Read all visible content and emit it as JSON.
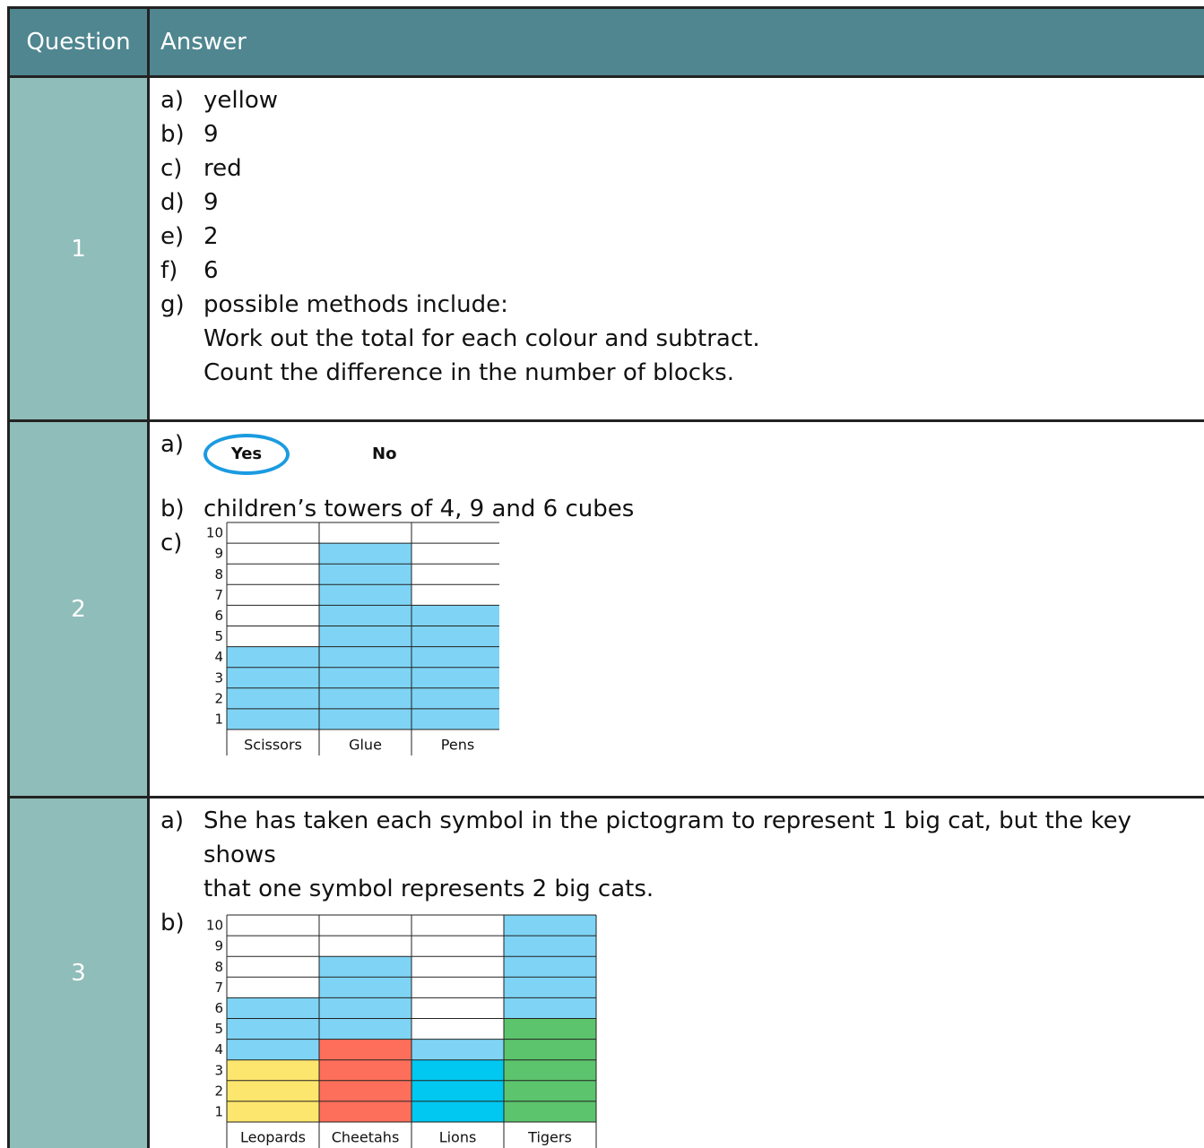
{
  "header": {
    "question": "Question",
    "answer": "Answer"
  },
  "colors": {
    "header_bg": "#4f8690",
    "question_col_bg": "#8fbdb9",
    "bar_blue": "#7fd4f5",
    "circle": "#1a9be0",
    "yellow": "#fde66d",
    "red": "#fe6f5b",
    "cyan": "#00c8f0",
    "green": "#5cc46c"
  },
  "q1": {
    "number": "1",
    "items": [
      {
        "label": "a)",
        "text": "yellow"
      },
      {
        "label": "b)",
        "text": "9"
      },
      {
        "label": "c)",
        "text": "red"
      },
      {
        "label": "d)",
        "text": "9"
      },
      {
        "label": "e)",
        "text": "2"
      },
      {
        "label": "f)",
        "text": "6"
      },
      {
        "label": "g)",
        "text": "possible methods include:"
      }
    ],
    "g_line2": "Work out the total for each colour and subtract.",
    "g_line3": "Count the difference in the number of blocks."
  },
  "q2": {
    "number": "2",
    "a_label": "a)",
    "yes": "Yes",
    "no": "No",
    "b_label": "b)",
    "b_text": "children’s towers of 4, 9 and 6 cubes",
    "c_label": "c)"
  },
  "q3": {
    "number": "3",
    "a_label": "a)",
    "a_line1": "She has taken each symbol in the pictogram to represent 1 big cat, but the key shows",
    "a_line2": "that one symbol represents 2 big cats.",
    "b_label": "b)"
  },
  "chart_data": [
    {
      "type": "bar",
      "categories": [
        "Scissors",
        "Glue",
        "Pens"
      ],
      "values": [
        4,
        9,
        6
      ],
      "ylim": [
        0,
        10
      ],
      "yticks": [
        "1",
        "2",
        "3",
        "4",
        "5",
        "6",
        "7",
        "8",
        "9",
        "10"
      ],
      "grid": true,
      "colors": [
        "#7fd4f5"
      ]
    },
    {
      "type": "bar",
      "categories": [
        "Leopards",
        "Cheetahs",
        "Lions",
        "Tigers"
      ],
      "series": [
        {
          "values": [
            3,
            4,
            3,
            5
          ],
          "colors": [
            "#fde66d",
            "#fe6f5b",
            "#00c8f0",
            "#5cc46c"
          ]
        },
        {
          "values": [
            3,
            4,
            1,
            5
          ],
          "colors": [
            "#7fd4f5",
            "#7fd4f5",
            "#7fd4f5",
            "#7fd4f5"
          ]
        }
      ],
      "ylim": [
        0,
        10
      ],
      "yticks": [
        "1",
        "2",
        "3",
        "4",
        "5",
        "6",
        "7",
        "8",
        "9",
        "10"
      ],
      "grid": true
    }
  ]
}
